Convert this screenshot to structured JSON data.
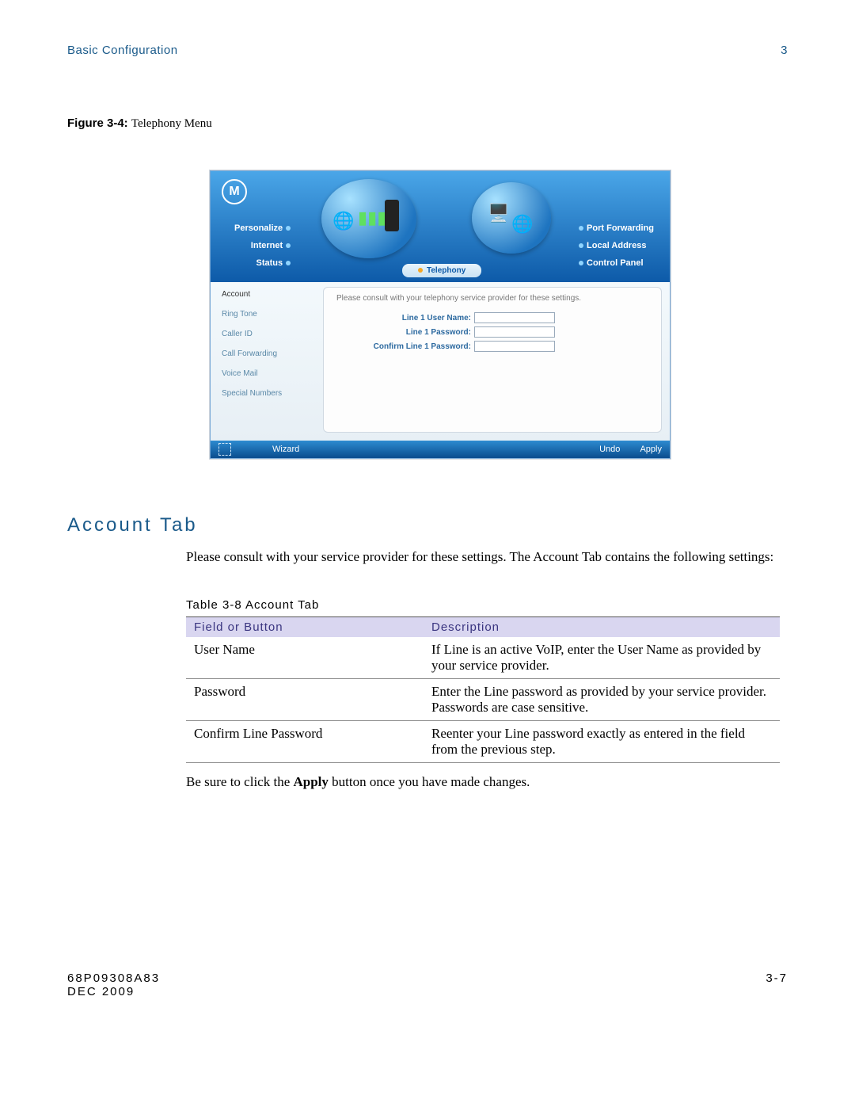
{
  "header": {
    "left": "Basic Configuration",
    "right": "3"
  },
  "figure": {
    "prefix": "Figure 3-4:",
    "title": "Telephony Menu"
  },
  "screenshot": {
    "logo_letter": "M",
    "nav_left": [
      "Personalize",
      "Internet",
      "Status"
    ],
    "nav_right": [
      "Port Forwarding",
      "Local Address",
      "Control Panel"
    ],
    "active_tab": "Telephony",
    "side_items": [
      "Account",
      "Ring Tone",
      "Caller ID",
      "Call Forwarding",
      "Voice Mail",
      "Special Numbers"
    ],
    "hint": "Please consult with your telephony service provider for these settings.",
    "fields": {
      "user": "Line 1 User Name:",
      "pass": "Line 1 Password:",
      "confirm": "Confirm Line 1 Password:"
    },
    "footer": {
      "wizard": "Wizard",
      "undo": "Undo",
      "apply": "Apply"
    }
  },
  "section": {
    "heading": "Account Tab",
    "para": "Please consult with your service provider for these settings. The Account Tab contains the following settings:"
  },
  "table": {
    "caption": "Table 3-8 Account Tab",
    "headers": {
      "field": "Field or Button",
      "desc": "Description"
    },
    "rows": [
      {
        "f": "User Name",
        "d": "If Line is an active VoIP, enter the User Name as provided by your service provider."
      },
      {
        "f": "Password",
        "d": "Enter the Line password as provided by your service provider. Passwords are case sensitive."
      },
      {
        "f": "Confirm Line Password",
        "d": "Reenter your Line password exactly as entered in the field from the previous step."
      }
    ]
  },
  "note": {
    "pre": "Be sure to click the ",
    "bold": "Apply",
    "post": " button once you have made changes."
  },
  "footer": {
    "doc_id": "68P09308A83",
    "date": "DEC 2009",
    "page": "3-7"
  }
}
